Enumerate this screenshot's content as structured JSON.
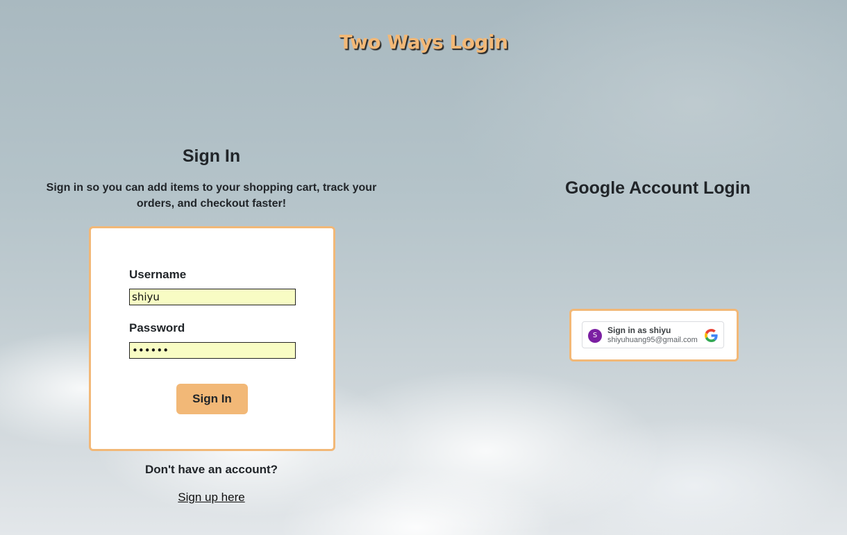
{
  "header": {
    "title": "Two Ways Login"
  },
  "signin": {
    "heading": "Sign In",
    "subtitle": "Sign in so you can add items to your shopping cart, track your orders, and checkout faster!",
    "username_label": "Username",
    "username_value": "shiyu",
    "password_label": "Password",
    "password_value": "••••••",
    "button_label": "Sign In",
    "no_account_text": "Don't have an account?",
    "signup_link": "Sign up here"
  },
  "google": {
    "heading": "Google Account Login",
    "avatar_letter": "S",
    "signin_as": "Sign in as shiyu",
    "email": "shiyuhuang95@gmail.com",
    "icon": "google-g-logo"
  },
  "colors": {
    "accent": "#f2b877",
    "input_bg": "#f8fcc4",
    "avatar_bg": "#7b1fa2",
    "text": "#212529"
  }
}
